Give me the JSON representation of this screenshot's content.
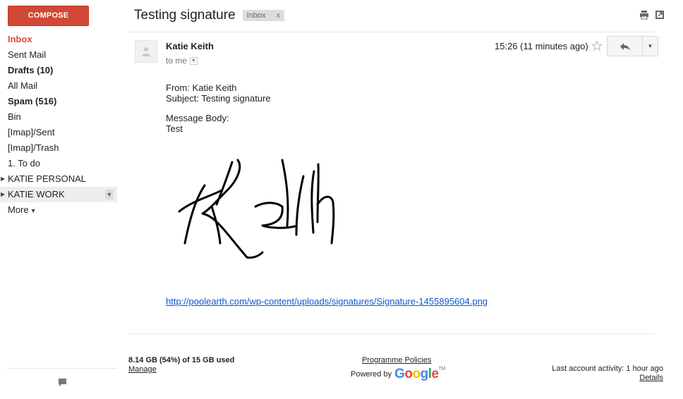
{
  "sidebar": {
    "compose_label": "COMPOSE",
    "items": [
      {
        "label": "Inbox"
      },
      {
        "label": "Sent Mail"
      },
      {
        "label": "Drafts (10)"
      },
      {
        "label": "All Mail"
      },
      {
        "label": "Spam (516)"
      },
      {
        "label": "Bin"
      },
      {
        "label": "[Imap]/Sent"
      },
      {
        "label": "[Imap]/Trash"
      },
      {
        "label": "1. To do"
      },
      {
        "label": "KATIE PERSONAL"
      },
      {
        "label": "KATIE WORK"
      },
      {
        "label": "More"
      }
    ]
  },
  "message": {
    "subject": "Testing signature",
    "label_chip": "Inbox",
    "label_chip_close": "x",
    "sender": "Katie Keith",
    "recipient": "to me",
    "timestamp": "15:26 (11 minutes ago)",
    "body": {
      "from_line": "From: Katie Keith",
      "subject_line": "Subject: Testing signature",
      "body_heading": "Message Body:",
      "body_text": "Test"
    },
    "signature_link": "http://poolearth.com/wp-content/uploads/signatures/Signature-1455895604.png"
  },
  "footer": {
    "storage_used": "8.14 GB (54%) of 15 GB used",
    "manage_label": "Manage",
    "policies_label": "Programme Policies",
    "powered_by": "Powered by",
    "google_logo": "Google",
    "activity": "Last account activity: 1 hour ago",
    "details_label": "Details"
  },
  "colors": {
    "compose": "#d14836",
    "inbox_active": "#dd4b39",
    "link": "#1155cc"
  },
  "icons": [
    "print-icon",
    "new-window-icon",
    "avatar-icon",
    "star-icon",
    "reply-icon",
    "dropdown-icon",
    "chat-icon"
  ]
}
